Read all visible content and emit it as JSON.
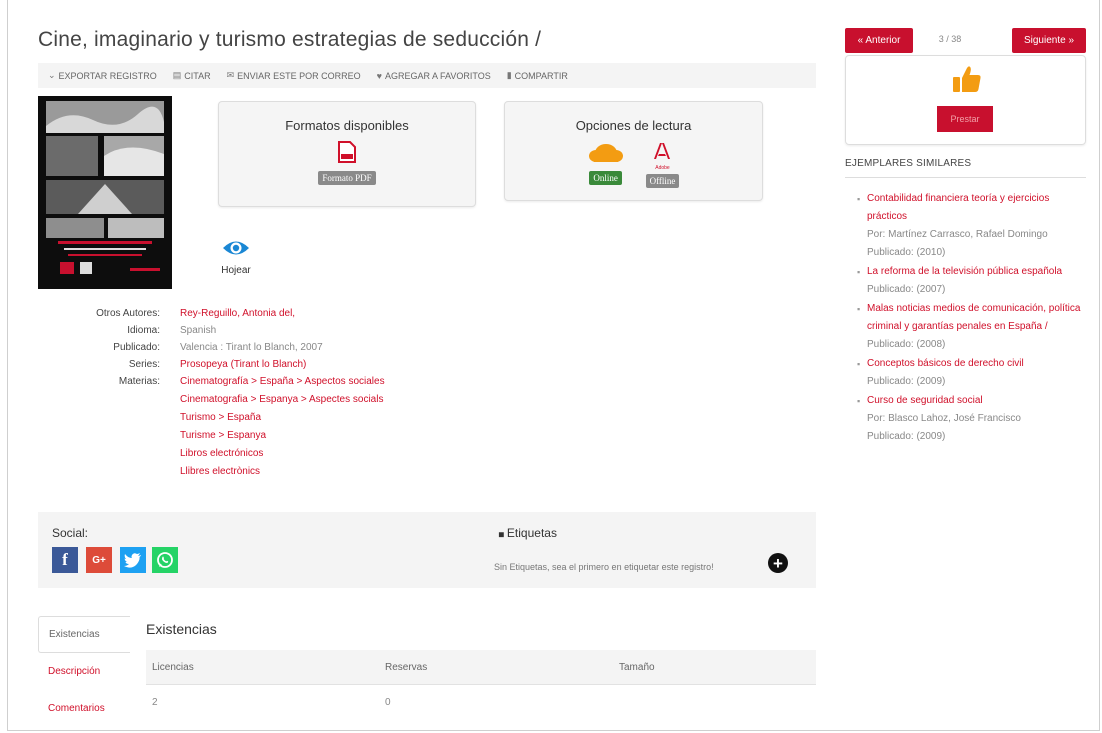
{
  "record": {
    "title": "Cine, imaginario y turismo estrategias de seducción /"
  },
  "toolbar": {
    "export": "EXPORTAR REGISTRO",
    "cite": "CITAR",
    "email": "ENVIAR ESTE POR CORREO",
    "favorites": "AGREGAR A FAVORITOS",
    "share": "COMPARTIR"
  },
  "formats": {
    "title": "Formatos disponibles",
    "pdf_badge": "Formato PDF"
  },
  "reading": {
    "title": "Opciones de lectura",
    "online": "Online",
    "offline": "Offline",
    "adobe_label": "Adobe"
  },
  "browse": {
    "label": "Hojear"
  },
  "details": {
    "other_authors_label": "Otros Autores:",
    "other_authors": "Rey-Reguillo, Antonia del,",
    "language_label": "Idioma:",
    "language": "Spanish",
    "published_label": "Publicado:",
    "published": "Valencia : Tirant lo Blanch, 2007",
    "series_label": "Series:",
    "series": "Prosopeya (Tirant lo Blanch)",
    "subjects_label": "Materias:",
    "subjects": [
      "Cinematografía > España > Aspectos sociales",
      "Cinematografia > Espanya > Aspectes socials",
      "Turismo > España",
      "Turisme > Espanya",
      "Libros electrónicos",
      "Llibres electrònics"
    ]
  },
  "social": {
    "label": "Social:",
    "facebook": "f",
    "google": "G+",
    "tags_title": "Etiquetas",
    "tags_empty": "Sin Etiquetas, sea el primero en etiquetar este registro!"
  },
  "tabs": [
    "Existencias",
    "Descripción",
    "Comentarios"
  ],
  "holdings": {
    "title": "Existencias",
    "columns": [
      "Licencias",
      "Reservas",
      "Tamaño"
    ],
    "rows": [
      [
        "2",
        "0",
        ""
      ]
    ]
  },
  "nav": {
    "prev": "« Anterior",
    "position": "3 / 38",
    "next": "Siguiente »",
    "borrow": "Prestar"
  },
  "similar": {
    "title": "EJEMPLARES SIMILARES",
    "items": [
      {
        "title": "Contabilidad financiera teoría y ejercicios prácticos",
        "author": "Por: Martínez Carrasco, Rafael Domingo",
        "published": "Publicado: (2010)"
      },
      {
        "title": "La reforma de la televisión pública española",
        "author": "",
        "published": "Publicado: (2007)"
      },
      {
        "title": "Malas noticias medios de comunicación, política criminal y garantías penales en España /",
        "author": "",
        "published": "Publicado: (2008)"
      },
      {
        "title": "Conceptos básicos de derecho civil",
        "author": "",
        "published": "Publicado: (2009)"
      },
      {
        "title": "Curso de seguridad social",
        "author": "Por: Blasco Lahoz, José Francisco",
        "published": "Publicado: (2009)"
      }
    ]
  },
  "colors": {
    "accent": "#d0102a",
    "button_red": "#c8102e",
    "online_green": "#3a8a3a",
    "offline_gray": "#8a8a8a",
    "cloud_orange": "#f39c12",
    "eye_blue": "#1a87d4"
  }
}
